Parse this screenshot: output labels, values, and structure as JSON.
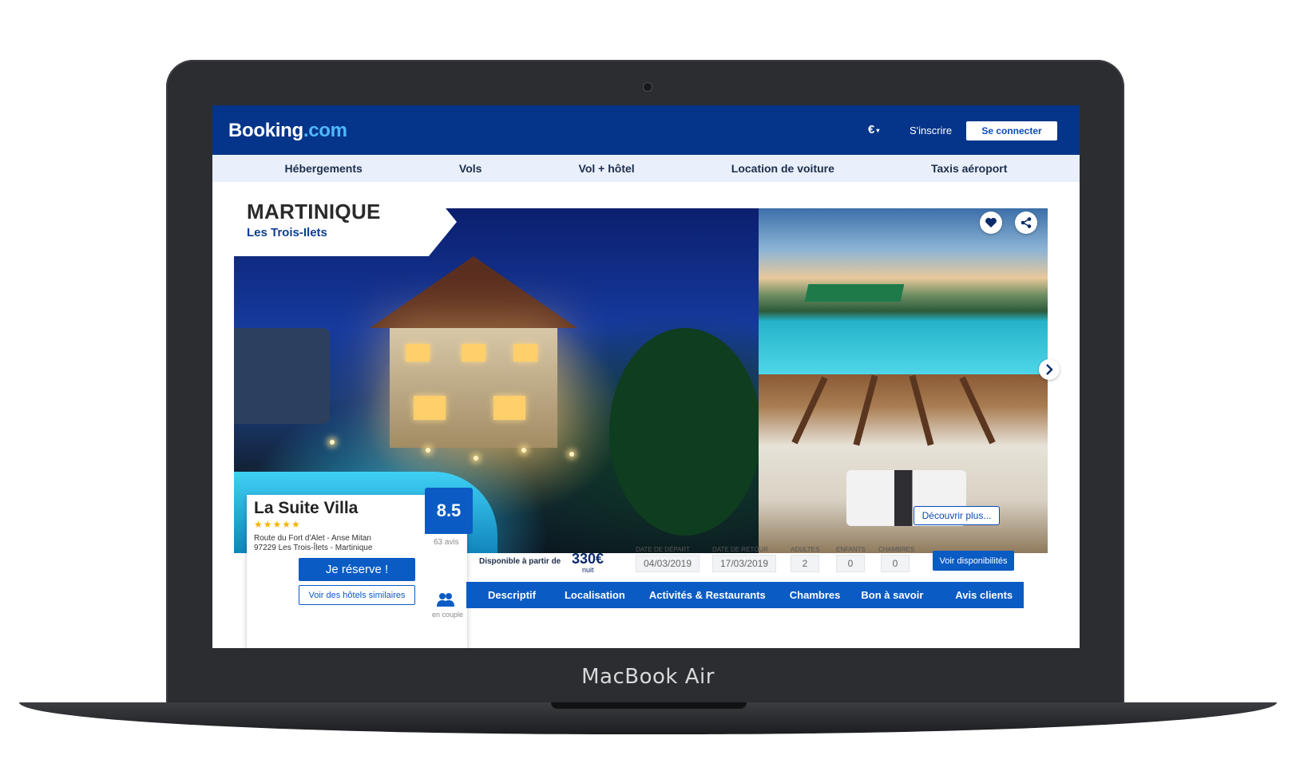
{
  "device": {
    "brand_label": "MacBook Air"
  },
  "header": {
    "logo_main": "Booking",
    "logo_suffix": ".com",
    "currency": "€",
    "signup_label": "S'inscrire",
    "login_label": "Se connecter"
  },
  "nav": {
    "items": [
      "Hébergements",
      "Vols",
      "Vol + hôtel",
      "Location de voiture",
      "Taxis aéroport"
    ]
  },
  "destination": {
    "title": "MARTINIQUE",
    "subtitle": "Les Trois-Ilets"
  },
  "hotel": {
    "name": "La Suite Villa",
    "stars": "★★★★★",
    "star_count": 5,
    "address_line1": "Route du Fort d'Alet - Anse Mitan",
    "address_line2": "97229 Les Trois-Îlets - Martinique",
    "score": "8.5",
    "reviews": "63 avis",
    "reserve_label": "Je réserve !",
    "similar_label": "Voir des hôtels similaires",
    "traveler_type": "en couple"
  },
  "gallery": {
    "discover_label": "Découvrir plus...",
    "icons": [
      "heart-icon",
      "share-icon",
      "chevron-right-icon"
    ]
  },
  "booking": {
    "available_label": "Disponible à partir de",
    "price": "330€",
    "price_unit": "nuit",
    "departure_label": "DATE DE DÉPART",
    "departure_value": "04/03/2019",
    "return_label": "DATE DE RETOUR",
    "return_value": "17/03/2019",
    "adults_label": "ADULTES",
    "adults_value": "2",
    "children_label": "ENFANTS",
    "children_value": "0",
    "rooms_label": "CHAMBRES",
    "rooms_value": "0",
    "availability_button": "Voir disponibilités"
  },
  "tabs": [
    "Descriptif",
    "Localisation",
    "Activités & Restaurants",
    "Chambres",
    "Bon à savoir",
    "Avis clients"
  ],
  "colors": {
    "brand_navy": "#05358a",
    "brand_blue": "#0a5bc4",
    "nav_bg": "#e9f0fb",
    "star_gold": "#f4b400"
  }
}
